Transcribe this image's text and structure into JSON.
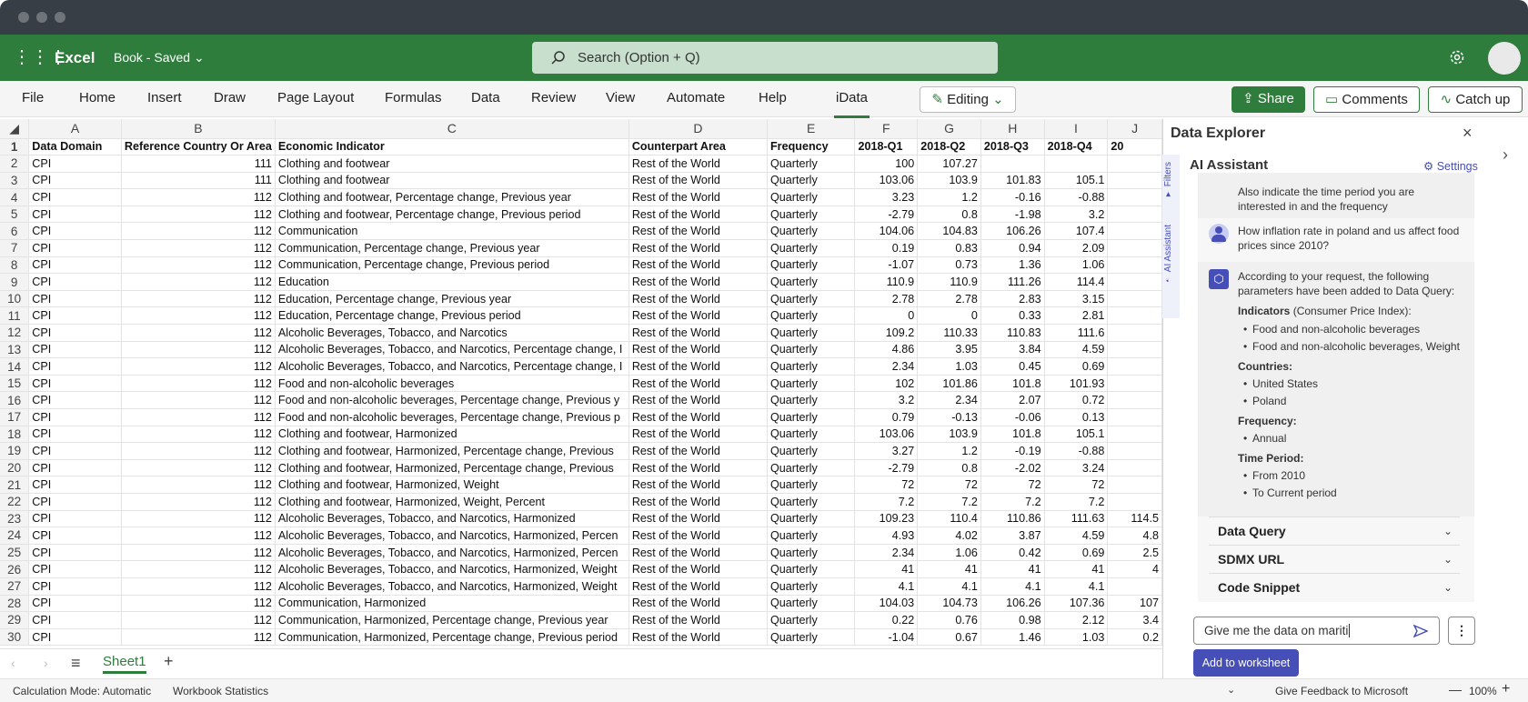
{
  "window": {
    "app": "Excel",
    "doc": "Book",
    "saved": "Saved"
  },
  "search": {
    "placeholder": "Search (Option + Q)"
  },
  "ribbon": {
    "tabs": [
      "File",
      "Home",
      "Insert",
      "Draw",
      "Page Layout",
      "Formulas",
      "Data",
      "Review",
      "View",
      "Automate",
      "Help",
      "iData"
    ],
    "active_tab": "iData",
    "editing": "Editing",
    "share": "Share",
    "comments": "Comments",
    "catchup": "Catch up"
  },
  "colors": {
    "brand": "#2f7d3c",
    "accent": "#464eb8"
  },
  "sheet": {
    "col_letters": [
      "A",
      "B",
      "C",
      "D",
      "E",
      "F",
      "G",
      "H",
      "I",
      "J"
    ],
    "row_numbers": [
      "1",
      "2",
      "3",
      "4",
      "5",
      "6",
      "7",
      "8",
      "9",
      "10",
      "11",
      "12",
      "13",
      "14",
      "15",
      "16",
      "17",
      "18",
      "19",
      "20",
      "21",
      "22",
      "23",
      "24",
      "25",
      "26",
      "27",
      "28",
      "29",
      "30"
    ],
    "header": [
      "Data Domain",
      "Reference Country Or Area",
      "Economic Indicator",
      "Counterpart Area",
      "Frequency",
      "2018-Q1",
      "2018-Q2",
      "2018-Q3",
      "2018-Q4",
      "20"
    ],
    "rows": [
      [
        "CPI",
        "111",
        "Clothing and footwear",
        "Rest of the World",
        "Quarterly",
        "100",
        "107.27",
        "",
        "",
        ""
      ],
      [
        "CPI",
        "111",
        "Clothing and footwear",
        "Rest of the World",
        "Quarterly",
        "103.06",
        "103.9",
        "101.83",
        "105.1",
        ""
      ],
      [
        "CPI",
        "112",
        "Clothing and footwear, Percentage change, Previous year",
        "Rest of the World",
        "Quarterly",
        "3.23",
        "1.2",
        "-0.16",
        "-0.88",
        ""
      ],
      [
        "CPI",
        "112",
        "Clothing and footwear, Percentage change, Previous period",
        "Rest of the World",
        "Quarterly",
        "-2.79",
        "0.8",
        "-1.98",
        "3.2",
        ""
      ],
      [
        "CPI",
        "112",
        "Communication",
        "Rest of the World",
        "Quarterly",
        "104.06",
        "104.83",
        "106.26",
        "107.4",
        ""
      ],
      [
        "CPI",
        "112",
        "Communication, Percentage change, Previous year",
        "Rest of the World",
        "Quarterly",
        "0.19",
        "0.83",
        "0.94",
        "2.09",
        ""
      ],
      [
        "CPI",
        "112",
        "Communication, Percentage change, Previous period",
        "Rest of the World",
        "Quarterly",
        "-1.07",
        "0.73",
        "1.36",
        "1.06",
        ""
      ],
      [
        "CPI",
        "112",
        "Education",
        "Rest of the World",
        "Quarterly",
        "110.9",
        "110.9",
        "111.26",
        "114.4",
        ""
      ],
      [
        "CPI",
        "112",
        "Education, Percentage change, Previous year",
        "Rest of the World",
        "Quarterly",
        "2.78",
        "2.78",
        "2.83",
        "3.15",
        ""
      ],
      [
        "CPI",
        "112",
        "Education, Percentage change, Previous period",
        "Rest of the World",
        "Quarterly",
        "0",
        "0",
        "0.33",
        "2.81",
        ""
      ],
      [
        "CPI",
        "112",
        "Alcoholic Beverages, Tobacco, and Narcotics",
        "Rest of the World",
        "Quarterly",
        "109.2",
        "110.33",
        "110.83",
        "111.6",
        ""
      ],
      [
        "CPI",
        "112",
        "Alcoholic Beverages, Tobacco, and Narcotics, Percentage change, I",
        "Rest of the World",
        "Quarterly",
        "4.86",
        "3.95",
        "3.84",
        "4.59",
        ""
      ],
      [
        "CPI",
        "112",
        "Alcoholic Beverages, Tobacco, and Narcotics, Percentage change, I",
        "Rest of the World",
        "Quarterly",
        "2.34",
        "1.03",
        "0.45",
        "0.69",
        ""
      ],
      [
        "CPI",
        "112",
        "Food and non-alcoholic beverages",
        "Rest of the World",
        "Quarterly",
        "102",
        "101.86",
        "101.8",
        "101.93",
        ""
      ],
      [
        "CPI",
        "112",
        "Food and non-alcoholic beverages, Percentage change, Previous y",
        "Rest of the World",
        "Quarterly",
        "3.2",
        "2.34",
        "2.07",
        "0.72",
        ""
      ],
      [
        "CPI",
        "112",
        "Food and non-alcoholic beverages, Percentage change, Previous p",
        "Rest of the World",
        "Quarterly",
        "0.79",
        "-0.13",
        "-0.06",
        "0.13",
        ""
      ],
      [
        "CPI",
        "112",
        "Clothing and footwear, Harmonized",
        "Rest of the World",
        "Quarterly",
        "103.06",
        "103.9",
        "101.8",
        "105.1",
        ""
      ],
      [
        "CPI",
        "112",
        "Clothing and footwear, Harmonized, Percentage change, Previous",
        "Rest of the World",
        "Quarterly",
        "3.27",
        "1.2",
        "-0.19",
        "-0.88",
        ""
      ],
      [
        "CPI",
        "112",
        "Clothing and footwear, Harmonized, Percentage change, Previous",
        "Rest of the World",
        "Quarterly",
        "-2.79",
        "0.8",
        "-2.02",
        "3.24",
        ""
      ],
      [
        "CPI",
        "112",
        "Clothing and footwear, Harmonized, Weight",
        "Rest of the World",
        "Quarterly",
        "72",
        "72",
        "72",
        "72",
        ""
      ],
      [
        "CPI",
        "112",
        "Clothing and footwear, Harmonized, Weight, Percent",
        "Rest of the World",
        "Quarterly",
        "7.2",
        "7.2",
        "7.2",
        "7.2",
        ""
      ],
      [
        "CPI",
        "112",
        "Alcoholic Beverages, Tobacco, and Narcotics, Harmonized",
        "Rest of the World",
        "Quarterly",
        "109.23",
        "110.4",
        "110.86",
        "111.63",
        "114.5"
      ],
      [
        "CPI",
        "112",
        "Alcoholic Beverages, Tobacco, and Narcotics, Harmonized, Percen",
        "Rest of the World",
        "Quarterly",
        "4.93",
        "4.02",
        "3.87",
        "4.59",
        "4.8"
      ],
      [
        "CPI",
        "112",
        "Alcoholic Beverages, Tobacco, and Narcotics, Harmonized, Percen",
        "Rest of the World",
        "Quarterly",
        "2.34",
        "1.06",
        "0.42",
        "0.69",
        "2.5"
      ],
      [
        "CPI",
        "112",
        "Alcoholic Beverages, Tobacco, and Narcotics, Harmonized, Weight",
        "Rest of the World",
        "Quarterly",
        "41",
        "41",
        "41",
        "41",
        "4"
      ],
      [
        "CPI",
        "112",
        "Alcoholic Beverages, Tobacco, and Narcotics, Harmonized, Weight",
        "Rest of the World",
        "Quarterly",
        "4.1",
        "4.1",
        "4.1",
        "4.1",
        ""
      ],
      [
        "CPI",
        "112",
        "Communication, Harmonized",
        "Rest of the World",
        "Quarterly",
        "104.03",
        "104.73",
        "106.26",
        "107.36",
        "107"
      ],
      [
        "CPI",
        "112",
        "Communication, Harmonized, Percentage change, Previous year",
        "Rest of the World",
        "Quarterly",
        "0.22",
        "0.76",
        "0.98",
        "2.12",
        "3.4"
      ],
      [
        "CPI",
        "112",
        "Communication, Harmonized, Percentage change, Previous period",
        "Rest of the World",
        "Quarterly",
        "-1.04",
        "0.67",
        "1.46",
        "1.03",
        "0.2"
      ]
    ],
    "tab": "Sheet1"
  },
  "status": {
    "calc": "Calculation Mode: Automatic",
    "stats": "Workbook Statistics",
    "feedback": "Give Feedback to Microsoft",
    "zoom": "100%"
  },
  "panel": {
    "title": "Data Explorer",
    "vtabs": [
      "Filters",
      "AI Assistant"
    ],
    "assistant_title": "AI Assistant",
    "settings": "Settings",
    "msg_partial": "Also indicate the time period you are interested in and the frequency",
    "user_msg": "How inflation rate in poland and us affect food prices since 2010?",
    "bot_intro": "According to your request, the following parameters have been added to Data Query:",
    "indicators_label": "Indicators",
    "indicators_note": "(Consumer Price Index):",
    "indicators": [
      "Food and non-alcoholic beverages",
      "Food and non-alcoholic beverages, Weight"
    ],
    "countries_label": "Countries:",
    "countries": [
      "United States",
      "Poland"
    ],
    "frequency_label": "Frequency:",
    "frequency": [
      "Annual"
    ],
    "time_label": "Time Period:",
    "time": [
      "From 2010",
      "To Current period"
    ],
    "sections": [
      "Data Query",
      "SDMX URL",
      "Code Snippet"
    ],
    "input_value": "Give me the data on mariti",
    "add_button": "Add to worksheet"
  }
}
